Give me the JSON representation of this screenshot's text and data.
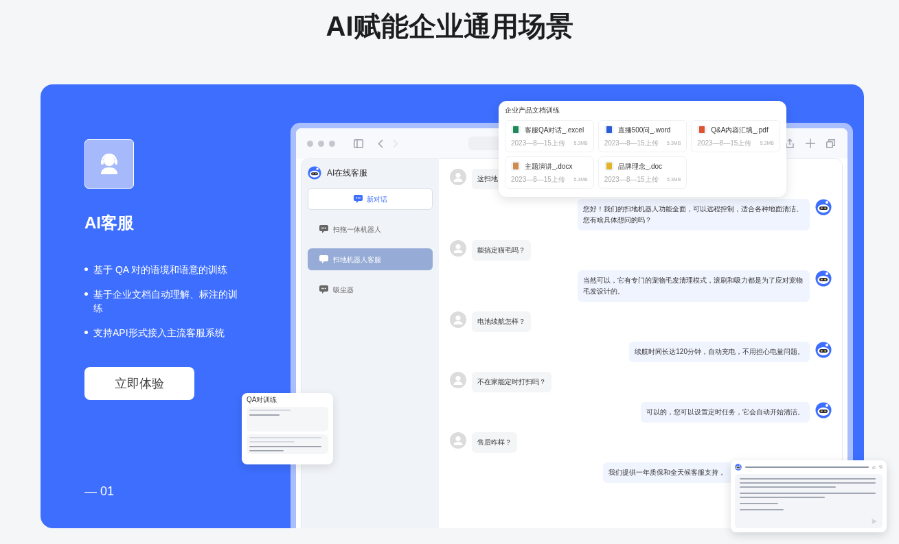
{
  "page_title": "AI赋能企业通用场景",
  "feature": {
    "title": "AI客服",
    "bullets": [
      "基于 QA 对的语境和语意的训练",
      "基于企业文档自动理解、标注的训练",
      "支持API形式接入主流客服系统"
    ],
    "button": "立即体验",
    "index": "— 01"
  },
  "app": {
    "sidebar": {
      "title": "AI在线客服",
      "new_chat": "新对话",
      "items": [
        {
          "label": "扫拖一体机器人",
          "selected": false
        },
        {
          "label": "扫地机器人客服",
          "selected": true
        },
        {
          "label": "吸尘器",
          "selected": false
        }
      ]
    },
    "messages": [
      {
        "kind": "user",
        "text": "这扫地"
      },
      {
        "kind": "bot",
        "text": "您好！我们的扫地机器人功能全面，可以远程控制，适合各种地面清洁。您有啥具体想问的吗？"
      },
      {
        "kind": "user",
        "text": "能搞定猫毛吗？"
      },
      {
        "kind": "bot",
        "text": "当然可以，它有专门的宠物毛发清理模式，滚刷和吸力都是为了应对宠物毛发设计的。"
      },
      {
        "kind": "user",
        "text": "电池续航怎样？"
      },
      {
        "kind": "bot",
        "text": "续航时间长达120分钟，自动充电，不用担心电量问题。"
      },
      {
        "kind": "user",
        "text": "不在家能定时打扫吗？"
      },
      {
        "kind": "bot",
        "text": "可以的，您可以设置定时任务，它会自动开始清洁。"
      },
      {
        "kind": "user",
        "text": "售后咋样？"
      },
      {
        "kind": "bot_cut",
        "text": "我们提供一年质保和全天候客服支持，"
      }
    ]
  },
  "file_panel": {
    "title": "企业产品文档训练",
    "files": [
      {
        "name": "客服QA对话_.excel",
        "date": "2023—8—15上传",
        "size": "5.3MB",
        "color": "#1f8a55"
      },
      {
        "name": "直播500问_.word",
        "date": "2023—8—15上传",
        "size": "5.3MB",
        "color": "#2b5bd7"
      },
      {
        "name": "Q&A内容汇填_.pdf",
        "date": "2023—8—15上传",
        "size": "5.3MB",
        "color": "#e0532f"
      },
      {
        "name": "主题演讲_.docx",
        "date": "2023—8—15上传",
        "size": "5.3MB",
        "color": "#d08a4a"
      },
      {
        "name": "品牌理念_.doc",
        "date": "2023—8—15上传",
        "size": "5.3MB",
        "color": "#e2b325"
      }
    ]
  },
  "qa_card": {
    "title": "QA对训练"
  }
}
